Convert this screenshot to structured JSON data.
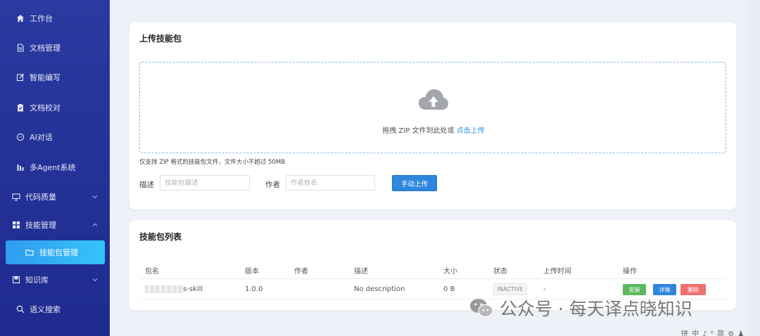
{
  "sidebar": {
    "items": [
      {
        "label": "工作台",
        "icon": "home-icon"
      },
      {
        "label": "文档管理",
        "icon": "document-icon"
      },
      {
        "label": "智能编写",
        "icon": "edit-icon"
      },
      {
        "label": "文档校对",
        "icon": "clipboard-check-icon"
      },
      {
        "label": "AI对话",
        "icon": "chat-icon"
      },
      {
        "label": "多Agent系统",
        "icon": "bar-chart-icon"
      },
      {
        "label": "代码质量",
        "icon": "monitor-icon"
      },
      {
        "label": "技能管理",
        "icon": "grid-icon"
      },
      {
        "label": "技能包管理",
        "icon": "folder-icon"
      },
      {
        "label": "知识库",
        "icon": "book-icon"
      },
      {
        "label": "语义搜索",
        "icon": "search-icon"
      }
    ],
    "accent": "#2f9bf0"
  },
  "upload": {
    "title": "上传技能包",
    "drop_text": "拖拽 ZIP 文件到此处或",
    "drop_link": "点击上传",
    "hint": "仅支持 ZIP 格式的技能包文件，文件大小不超过 50MB",
    "desc_label": "描述",
    "desc_placeholder": "技能包描述",
    "author_label": "作者",
    "author_placeholder": "作者姓名",
    "button": "手动上传"
  },
  "list": {
    "title": "技能包列表",
    "columns": [
      "包名",
      "版本",
      "作者",
      "描述",
      "大小",
      "状态",
      "上传时间",
      "操作"
    ],
    "rows": [
      {
        "name": "s-skill",
        "version": "1.0.0",
        "author": "",
        "description": "No description",
        "size": "0 B",
        "status": "INACTIVE",
        "upload_time": "-"
      }
    ],
    "actions": {
      "install": "安装",
      "detail": "详情",
      "delete": "删除"
    },
    "colors": {
      "install": "#5cb85c",
      "detail": "#2f86de",
      "delete": "#f07070"
    }
  },
  "watermark": "公众号 · 每天译点晓知识",
  "tray": "拼 中 ♪ ⁰ 简 ⚙ ♟"
}
